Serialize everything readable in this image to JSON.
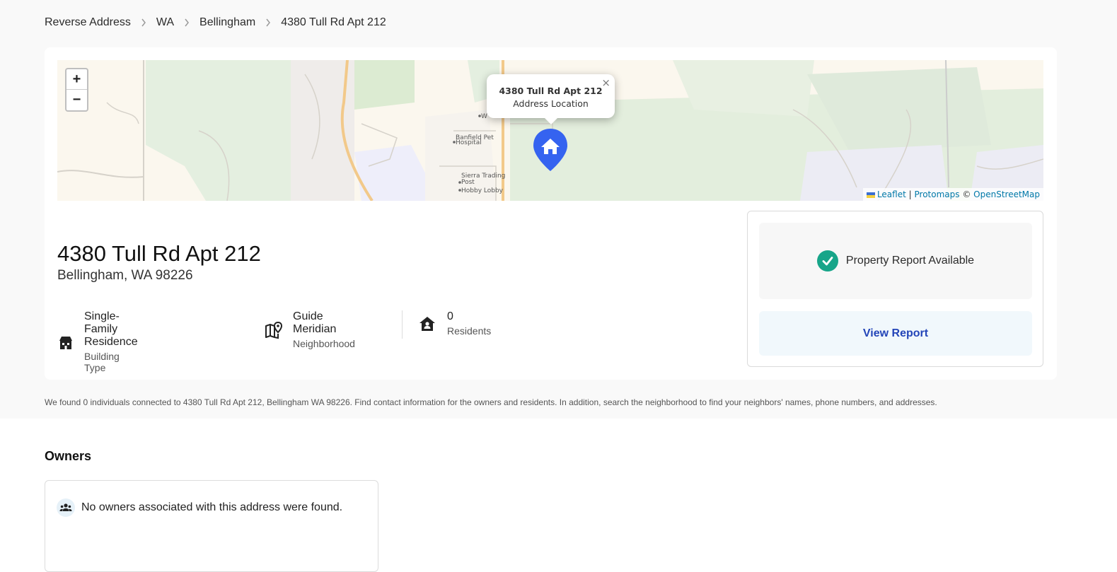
{
  "breadcrumb": {
    "items": [
      "Reverse Address",
      "WA",
      "Bellingham",
      "4380 Tull Rd Apt 212"
    ]
  },
  "map": {
    "zoom_in": "+",
    "zoom_out": "−",
    "popup": {
      "title": "4380 Tull Rd Apt 212",
      "subtitle": "Address Location",
      "close": "×"
    },
    "labels": {
      "banfield_1": "Banfield Pet",
      "banfield_2": "Hospital",
      "sierra_1": "Sierra Trading",
      "sierra_2": "Post",
      "hobby": "Hobby Lobby",
      "w": "W"
    },
    "attribution": {
      "leaflet": "Leaflet",
      "sep1": "|",
      "protomaps": "Protomaps",
      "copy": "©",
      "osm": "OpenStreetMap"
    },
    "marker_color": "#3563f0"
  },
  "property": {
    "address": "4380 Tull Rd Apt 212",
    "city_line": "Bellingham, WA 98226"
  },
  "stats": [
    {
      "value": "Single-Family Residence",
      "label": "Building Type",
      "icon": "building-icon"
    },
    {
      "value": "Guide Meridian",
      "label": "Neighborhood",
      "icon": "map-pin-icon"
    },
    {
      "value": "0",
      "label": "Residents",
      "icon": "house-user-icon"
    }
  ],
  "report": {
    "status": "Property Report Available",
    "button": "View Report",
    "accent": "#17a589",
    "button_color": "#2345b8"
  },
  "disclaimer": "We found 0 individuals connected to 4380 Tull Rd Apt 212, Bellingham WA 98226. Find contact information for the owners and residents. In addition, search the neighborhood to find your neighbors' names, phone numbers, and addresses.",
  "owners": {
    "title": "Owners",
    "empty_message": "No owners associated with this address were found."
  }
}
